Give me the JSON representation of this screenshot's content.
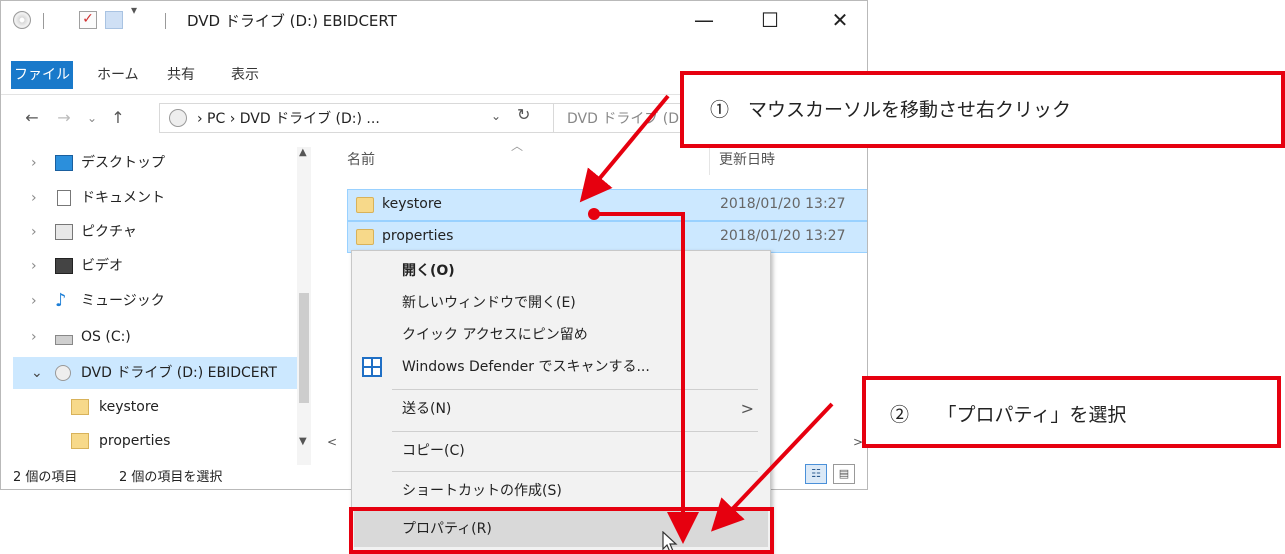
{
  "window": {
    "title": "DVD ドライブ (D:) EBIDCERT",
    "buttons": {
      "minimize": "—",
      "maximize": "☐",
      "close": "✕"
    }
  },
  "quick_access": {
    "arrow": "▾"
  },
  "ribbon": {
    "tabs": [
      "ファイル",
      "ホーム",
      "共有",
      "表示"
    ]
  },
  "address_bar": {
    "back": "←",
    "forward": "→",
    "recent": "⌄",
    "up": "↑",
    "path": "› PC › DVD ドライブ (D:) ...",
    "dropdown": "⌄",
    "refresh": "↻",
    "search_text": "DVD ドライブ (D"
  },
  "nav_pane": {
    "items": [
      {
        "label": "デスクトップ",
        "icon": "desktop-icon"
      },
      {
        "label": "ドキュメント",
        "icon": "documents-icon"
      },
      {
        "label": "ピクチャ",
        "icon": "pictures-icon"
      },
      {
        "label": "ビデオ",
        "icon": "video-icon"
      },
      {
        "label": "ミュージック",
        "icon": "music-icon"
      },
      {
        "label": "OS (C:)",
        "icon": "drive-icon"
      },
      {
        "label": "DVD ドライブ (D:) EBIDCERT",
        "icon": "dvd-icon"
      },
      {
        "label": "keystore",
        "icon": "folder-icon"
      },
      {
        "label": "properties",
        "icon": "folder-icon"
      }
    ],
    "chevron_closed": "›",
    "chevron_open": "⌄"
  },
  "content": {
    "columns": {
      "name": "名前",
      "date": "更新日時"
    },
    "files": [
      {
        "name": "keystore",
        "date": "2018/01/20 13:27"
      },
      {
        "name": "properties",
        "date": "2018/01/20 13:27"
      }
    ]
  },
  "status_bar": {
    "count": "2 個の項目",
    "selected": "2 個の項目を選択"
  },
  "context_menu": {
    "open": "開く(O)",
    "open_new_window": "新しいウィンドウで開く(E)",
    "pin_quick_access": "クイック アクセスにピン留め",
    "defender": "Windows Defender でスキャンする...",
    "send_to": "送る(N)",
    "copy": "コピー(C)",
    "create_shortcut": "ショートカットの作成(S)",
    "properties": "プロパティ(R)"
  },
  "annotations": {
    "step1": "①　マウスカーソルを移動させ右クリック",
    "step2": "②　　「プロパティ」を選択"
  },
  "colors": {
    "accent": "#1979ca",
    "selection": "#cce8ff",
    "annotation": "#e6000f"
  }
}
